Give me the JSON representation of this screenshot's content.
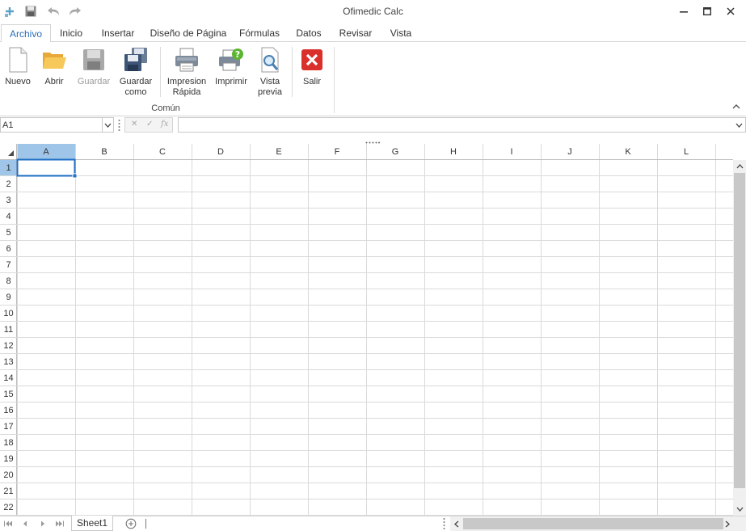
{
  "app": {
    "title": "Ofimedic Calc",
    "quick_access": [
      "app-icon",
      "save-icon",
      "undo-icon",
      "redo-icon"
    ],
    "window_controls": [
      "minimize-icon",
      "maximize-icon",
      "close-icon"
    ]
  },
  "tabs": [
    {
      "label": "Archivo",
      "active": true
    },
    {
      "label": "Inicio",
      "active": false
    },
    {
      "label": "Insertar",
      "active": false
    },
    {
      "label": "Diseño de Página",
      "active": false
    },
    {
      "label": "Fórmulas",
      "active": false
    },
    {
      "label": "Datos",
      "active": false
    },
    {
      "label": "Revisar",
      "active": false
    },
    {
      "label": "Vista",
      "active": false
    }
  ],
  "ribbon": {
    "buttons": {
      "nuevo": {
        "line1": "Nuevo",
        "line2": "",
        "icon": "new-document-icon"
      },
      "abrir": {
        "line1": "Abrir",
        "line2": "",
        "icon": "open-folder-icon"
      },
      "guardar": {
        "line1": "Guardar",
        "line2": "",
        "icon": "save-icon",
        "disabled": true
      },
      "guardar_como": {
        "line1": "Guardar",
        "line2": "como",
        "icon": "save-as-icon"
      },
      "impresion_rapida": {
        "line1": "Impresion",
        "line2": "Rápida",
        "icon": "quick-print-icon"
      },
      "imprimir": {
        "line1": "Imprimir",
        "line2": "",
        "icon": "print-icon"
      },
      "vista_previa": {
        "line1": "Vista",
        "line2": "previa",
        "icon": "print-preview-icon"
      },
      "salir": {
        "line1": "Salir",
        "line2": "",
        "icon": "exit-icon"
      }
    },
    "group_label": "Común"
  },
  "formula_bar": {
    "name_box": "A1",
    "cancel_symbol": "✕",
    "enter_symbol": "✓",
    "function_symbol": "fx",
    "formula_value": ""
  },
  "grid": {
    "columns": [
      "A",
      "B",
      "C",
      "D",
      "E",
      "F",
      "G",
      "H",
      "I",
      "J",
      "K",
      "L"
    ],
    "rows": [
      "1",
      "2",
      "3",
      "4",
      "5",
      "6",
      "7",
      "8",
      "9",
      "10",
      "11",
      "12",
      "13",
      "14",
      "15",
      "16",
      "17",
      "18",
      "19",
      "20",
      "21",
      "22"
    ],
    "selected_cell": "A1",
    "selected_column": "A",
    "selected_row": "1"
  },
  "sheets": {
    "tabs": [
      "Sheet1"
    ],
    "active": "Sheet1"
  },
  "colors": {
    "accent": "#2b6fb6",
    "selection_header": "#9fc5e8",
    "selection_border": "#1f6fc5",
    "grid_line": "#dadada",
    "exit_red": "#d9302c"
  }
}
